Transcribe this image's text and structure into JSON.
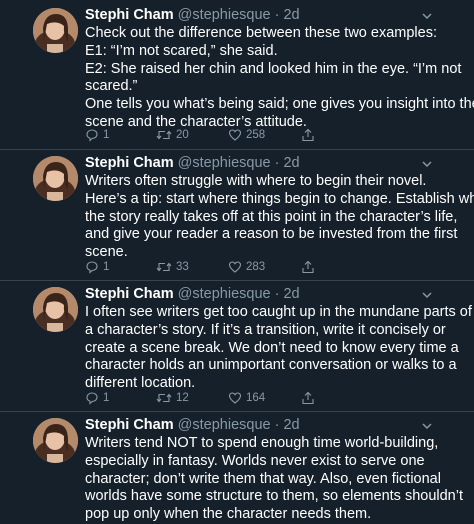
{
  "tweets": [
    {
      "name": "Stephi Cham",
      "handle": "@stephiesque",
      "time": "2d",
      "lines": [
        "Check out the difference between these two examples:",
        "E1: “I’m not scared,” she said.",
        "E2: She raised her chin and looked him in the eye. “I’m not",
        "scared.”",
        "One tells you what’s being said; one gives you insight into the",
        "scene and the character’s attitude."
      ],
      "replies": "1",
      "retweets": "20",
      "likes": "258"
    },
    {
      "name": "Stephi Cham",
      "handle": "@stephiesque",
      "time": "2d",
      "lines": [
        "Writers often struggle with where to begin their novel.",
        "Here’s a tip: start where things begin to change. Establish why",
        "the story really takes off at this point in the character’s life,",
        "and give your reader a reason to be invested from the first",
        "scene."
      ],
      "replies": "1",
      "retweets": "33",
      "likes": "283"
    },
    {
      "name": "Stephi Cham",
      "handle": "@stephiesque",
      "time": "2d",
      "lines": [
        "I often see writers get too caught up in the mundane parts of",
        "a character’s story. If it’s a transition, write it concisely or",
        "create a scene break. We don’t need to know every time a",
        "character holds an unimportant conversation or walks to a",
        "different location."
      ],
      "replies": "1",
      "retweets": "12",
      "likes": "164"
    },
    {
      "name": "Stephi Cham",
      "handle": "@stephiesque",
      "time": "2d",
      "lines": [
        "Writers tend NOT to spend enough time world-building,",
        "especially in fantasy. Worlds never exist to serve one",
        "character; don’t write them that way. Also, even fictional",
        "worlds have some structure to them, so elements shouldn’t",
        "pop up only when the character needs them."
      ],
      "replies": "",
      "retweets": "",
      "likes": ""
    }
  ],
  "icons": {
    "reply": "reply-icon",
    "retweet": "retweet-icon",
    "like": "heart-icon",
    "share": "share-icon",
    "menu": "chevron-down-icon",
    "avatar": "avatar"
  },
  "colors": {
    "background": "#15202b",
    "text": "#ffffff",
    "muted": "#8899a6",
    "divider": "#38444d"
  }
}
